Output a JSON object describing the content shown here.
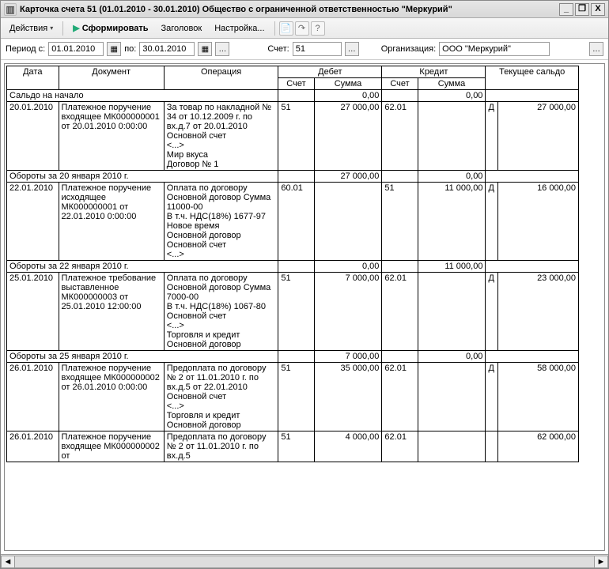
{
  "title": "Карточка счета 51 (01.01.2010 - 30.01.2010) Общество с ограниченной ответственностью \"Меркурий\"",
  "winbtns": {
    "min": "_",
    "restore": "❐",
    "close": "X"
  },
  "toolbar": {
    "actions_label": "Действия",
    "form_label": "Сформировать",
    "header_label": "Заголовок",
    "settings_label": "Настройка...",
    "help": "?"
  },
  "filter": {
    "period_label": "Период с:",
    "date_from": "01.01.2010",
    "to_label": "по:",
    "date_to": "30.01.2010",
    "account_label": "Счет:",
    "account": "51",
    "org_label": "Организация:",
    "org": "ООО \"Меркурий\""
  },
  "headers": {
    "date": "Дата",
    "doc": "Документ",
    "op": "Операция",
    "debit": "Дебет",
    "credit": "Кредит",
    "balance": "Текущее сальдо",
    "acct": "Счет",
    "sum": "Сумма"
  },
  "open_balance": {
    "label": "Сальдо на начало",
    "debit_sum": "0,00",
    "credit_sum": "0,00"
  },
  "rows": [
    {
      "date": "20.01.2010",
      "doc": "Платежное поручение входящее МК000000001 от 20.01.2010 0:00:00",
      "op": "За товар по накладной № 34 от 10.12.2009 г. по вх.д.7 от 20.01.2010\nОсновной счет\n<...>\nМир вкуса\nДоговор № 1",
      "d_acct": "51",
      "d_sum": "27 000,00",
      "c_acct": "62.01",
      "c_sum": "",
      "bal_dc": "Д",
      "bal": "27 000,00"
    },
    {
      "subtotal": "Обороты за 20 января 2010 г.",
      "d_sum": "27 000,00",
      "c_sum": "0,00"
    },
    {
      "date": "22.01.2010",
      "doc": "Платежное поручение исходящее МК000000001 от 22.01.2010 0:00:00",
      "op": "Оплата по договору Основной договор Сумма 11000-00\nВ т.ч. НДС(18%) 1677-97\nНовое время\nОсновной договор\nОсновной счет\n<...>",
      "d_acct": "60.01",
      "d_sum": "",
      "c_acct": "51",
      "c_sum": "11 000,00",
      "bal_dc": "Д",
      "bal": "16 000,00"
    },
    {
      "subtotal": "Обороты за 22 января 2010 г.",
      "d_sum": "0,00",
      "c_sum": "11 000,00"
    },
    {
      "date": "25.01.2010",
      "doc": "Платежное требование выставленное МК000000003 от 25.01.2010 12:00:00",
      "op": "Оплата по договору Основной договор Сумма 7000-00\nВ т.ч. НДС(18%) 1067-80\nОсновной счет\n<...>\nТорговля и кредит\nОсновной договор",
      "d_acct": "51",
      "d_sum": "7 000,00",
      "c_acct": "62.01",
      "c_sum": "",
      "bal_dc": "Д",
      "bal": "23 000,00"
    },
    {
      "subtotal": "Обороты за 25 января 2010 г.",
      "d_sum": "7 000,00",
      "c_sum": "0,00"
    },
    {
      "date": "26.01.2010",
      "doc": "Платежное поручение входящее МК000000002 от 26.01.2010 0:00:00",
      "op": "Предоплата по договору № 2 от 11.01.2010 г. по вх.д.5 от 22.01.2010\nОсновной счет\n<...>\nТорговля и кредит\nОсновной договор",
      "d_acct": "51",
      "d_sum": "35 000,00",
      "c_acct": "62.01",
      "c_sum": "",
      "bal_dc": "Д",
      "bal": "58 000,00"
    },
    {
      "date": "26.01.2010",
      "doc": "Платежное поручение входящее МК000000002 от",
      "op": "Предоплата по договору № 2 от 11.01.2010 г. по вх.д.5",
      "d_acct": "51",
      "d_sum": "4 000,00",
      "c_acct": "62.01",
      "c_sum": "",
      "bal_dc": "",
      "bal": "62 000,00"
    }
  ]
}
